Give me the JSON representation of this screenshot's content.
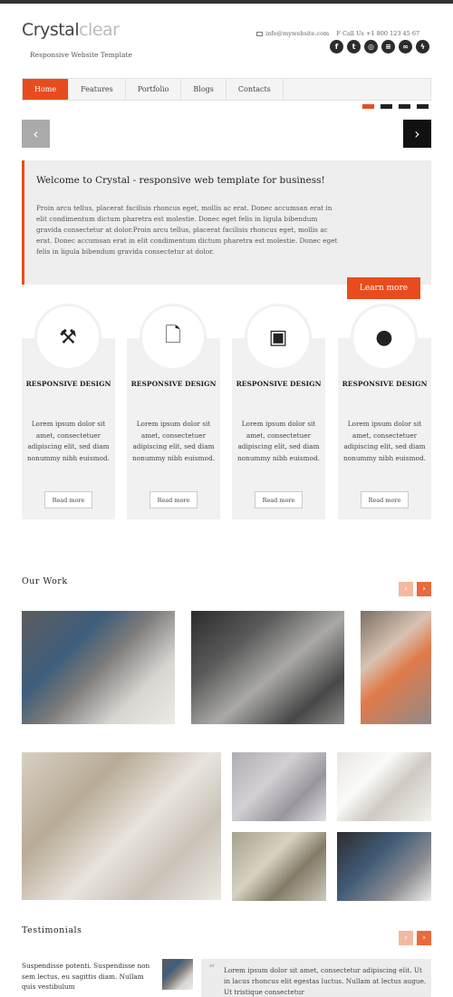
{
  "brand": {
    "name_part1": "Crystal",
    "name_part2": "clear",
    "tagline": "Responsive Website Template"
  },
  "contact": {
    "email": "info@mywebsite.com",
    "phone": "F  Call Us +1 800 123 45 67"
  },
  "social": [
    "f",
    "t",
    "dribbble",
    "forrst",
    "lastfm",
    "lightning"
  ],
  "nav": [
    {
      "label": "Home",
      "active": true
    },
    {
      "label": "Features",
      "active": false
    },
    {
      "label": "Portfolio",
      "active": false
    },
    {
      "label": "Blogs",
      "active": false
    },
    {
      "label": "Contacts",
      "active": false
    }
  ],
  "slider": {
    "prev": "‹",
    "next": "›"
  },
  "welcome": {
    "title": "Welcome to Crystal - responsive web template for business!",
    "body": "Proin arcu tellus, placerat facilisis rhoncus eget, mollis ac erat. Donec accumsan erat in elit condimentum dictum pharetra est molestie. Donec eget felis in ligula bibendum gravida consectetur at dolor.Proin arcu tellus, placerat facilisis rhoncus eget, mollis ac erat. Donec accumsan erat in elit condimentum dictum pharetra est molestie. Donec eget felis in ligula bibendum gravida consectetur at dolor.",
    "button": "Learn more"
  },
  "features": [
    {
      "icon": "tools-icon",
      "glyph": "⚒",
      "title": "RESPONSIVE DESIGN",
      "text": "Lorem ipsum dolor sit amet, consectetuer adipiscing elit, sed diam nonummy nibh euismod.",
      "button": "Read more"
    },
    {
      "icon": "add-document-icon",
      "glyph": "🗋",
      "title": "RESPONSIVE DESIGN",
      "text": "Lorem ipsum dolor sit amet, consectetuer adipiscing elit, sed diam nonummy nibh euismod.",
      "button": "Read more"
    },
    {
      "icon": "gallery-icon",
      "glyph": "▣",
      "title": "RESPONSIVE DESIGN",
      "text": "Lorem ipsum dolor sit amet, consectetuer adipiscing elit, sed diam nonummy nibh euismod.",
      "button": "Read more"
    },
    {
      "icon": "globe-icon",
      "glyph": "●",
      "title": "RESPONSIVE DESIGN",
      "text": "Lorem ipsum dolor sit amet, consectetuer adipiscing elit, sed diam nonummy nibh euismod.",
      "button": "Read more"
    }
  ],
  "our_work": {
    "title": "Our Work",
    "prev": "‹",
    "next": "›"
  },
  "testimonials": {
    "title": "Testimonials",
    "prev": "‹",
    "next": "›",
    "left_text": "Suspendisse potenti. Suspendisse non sem lectus, eu sagittis diam. Nullam quis vestibulum",
    "quote": "Lorem ipsum dolor sit amet, consectetur adipiscing elit. Ut in lacus rhoncus elit egestas luctus. Nullam at lectus augue. Ut tristique consectetur"
  },
  "colors": {
    "accent": "#e84c1e",
    "dark": "#222222",
    "panel": "#eeeeee"
  }
}
